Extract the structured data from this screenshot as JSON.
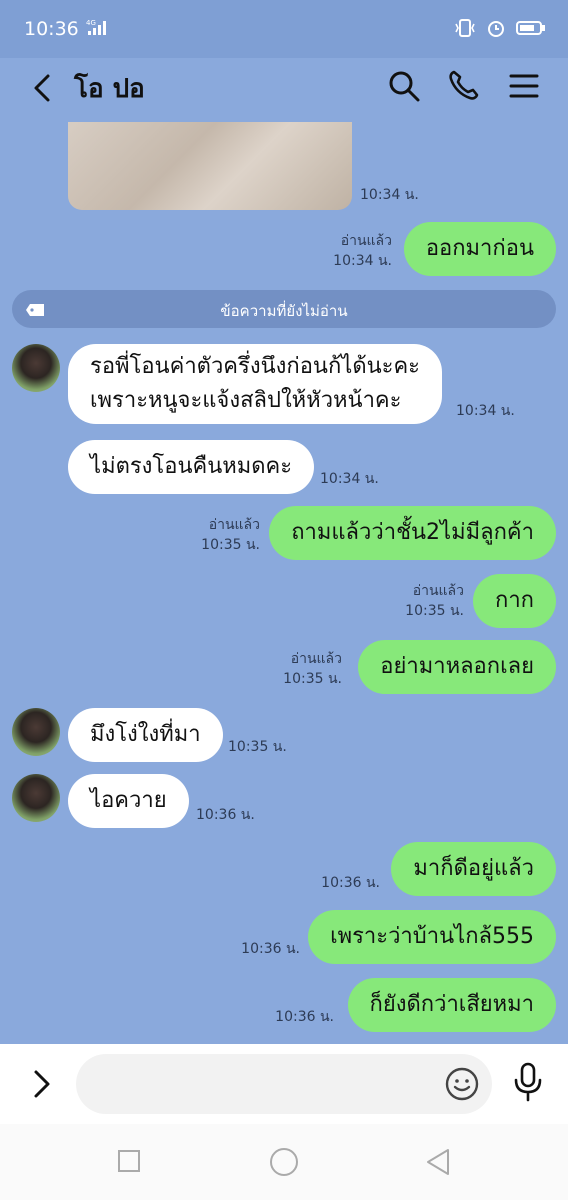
{
  "status": {
    "time": "10:36",
    "network": "4G"
  },
  "header": {
    "title": "โอ ปอ"
  },
  "unread_divider": "ข้อความที่ยังไม่อ่าน",
  "messages": [
    {
      "id": "m0",
      "type": "image",
      "time": "10:34 น."
    },
    {
      "id": "m1",
      "side": "out",
      "text": "ออกมาก่อน",
      "read": "อ่านแล้ว",
      "time": "10:34 น."
    },
    {
      "id": "m2",
      "side": "in",
      "text_lines": [
        "รอพี่โอนค่าตัวครึ่งนึงก่อนก้ได้นะคะ",
        "เพราะหนูจะแจ้งสลิปให้หัวหน้าคะ"
      ],
      "time": "10:34 น."
    },
    {
      "id": "m3",
      "side": "in",
      "text": "ไม่ตรงโอนคืนหมดคะ",
      "time": "10:34 น."
    },
    {
      "id": "m4",
      "side": "out",
      "text": "ถามแล้วว่าชั้น2ไม่มีลูกค้า",
      "read": "อ่านแล้ว",
      "time": "10:35 น."
    },
    {
      "id": "m5",
      "side": "out",
      "text": "กาก",
      "read": "อ่านแล้ว",
      "time": "10:35 น."
    },
    {
      "id": "m6",
      "side": "out",
      "text": "อย่ามาหลอกเลย",
      "read": "อ่านแล้ว",
      "time": "10:35 น."
    },
    {
      "id": "m7",
      "side": "in",
      "text": "มึงโง่ใงที่มา",
      "time": "10:35 น."
    },
    {
      "id": "m8",
      "side": "in",
      "text": "ไอควาย",
      "time": "10:36 น."
    },
    {
      "id": "m9",
      "side": "out",
      "text": "มาก็ดีอยู่แล้ว",
      "time": "10:36 น."
    },
    {
      "id": "m10",
      "side": "out",
      "text": "เพราะว่าบ้านไกล้555",
      "time": "10:36 น."
    },
    {
      "id": "m11",
      "side": "out",
      "text": "ก็ยังดีกว่าเสียหมา",
      "time": "10:36 น."
    }
  ],
  "input": {
    "placeholder": "",
    "value": ""
  },
  "colors": {
    "background": "#8aa9dc",
    "bubble_out": "#87e87a",
    "bubble_in": "#ffffff",
    "divider": "#7390c4"
  }
}
